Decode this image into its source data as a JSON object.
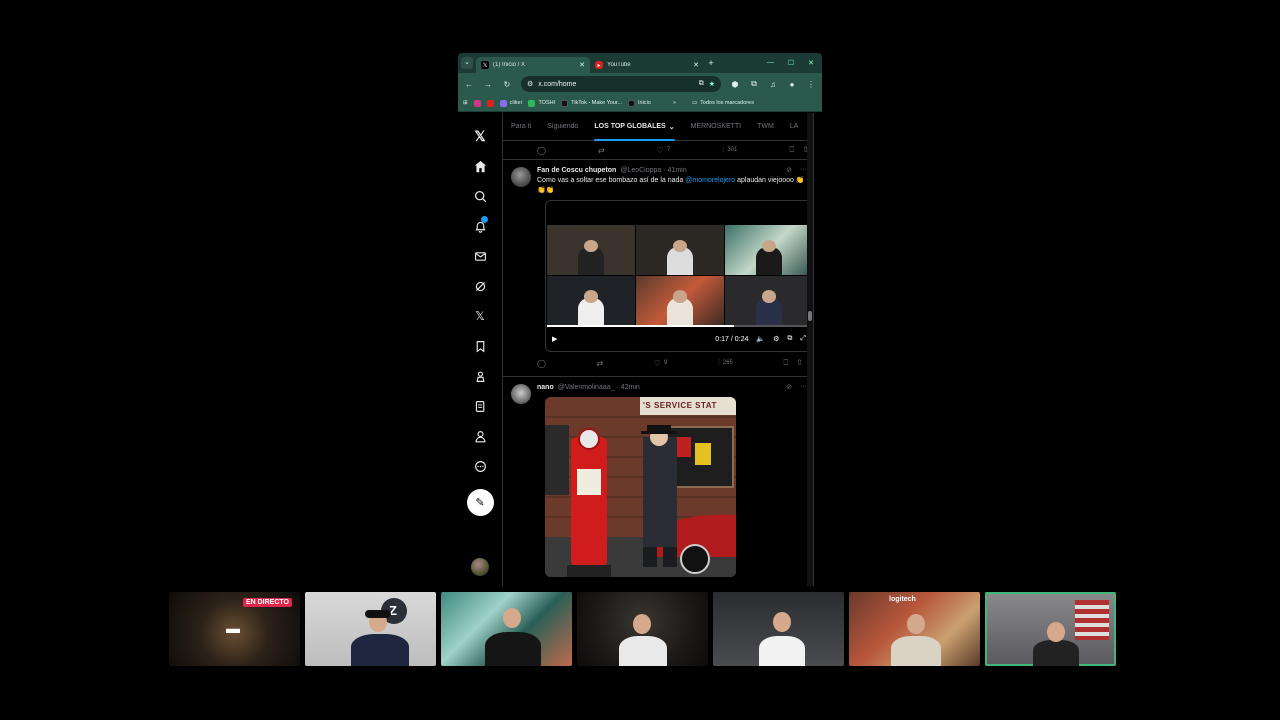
{
  "browser": {
    "tabs": [
      {
        "title": "(1) Inicio / X",
        "active": true
      },
      {
        "title": "YouTube",
        "active": false
      }
    ],
    "url": "x.com/home",
    "bookmarks": [
      {
        "label": "",
        "color": "#d1348b"
      },
      {
        "label": "",
        "color": "#e02020"
      },
      {
        "label": "cliker",
        "color": "#8a6cf0"
      },
      {
        "label": "TOSHI",
        "color": "#2db85c"
      },
      {
        "label": "TikTok - Make Your...",
        "color": "#111111"
      },
      {
        "label": "Inicio",
        "color": "#111111"
      }
    ],
    "bookmarks_overflow": "»",
    "all_bookmarks": "Todos los marcadores"
  },
  "x": {
    "feed_tabs": [
      "Para ti",
      "Siguiendo",
      "LOS TOP GLOBALES",
      "MERNOSKETTI",
      "TWM",
      "LA"
    ],
    "top_actions": {
      "likes": "7",
      "views": "301"
    },
    "tweet1": {
      "name": "Fan de Coscu chupeton",
      "handle": "@LeoCioppa · 41min",
      "text_before": "Como vas a soltar ese bombazo así de la nada ",
      "mention": "@momorelojero",
      "text_after": " aplaudan viejoooo 👏👏👏",
      "video_time": "0:17 / 0:24",
      "video_progress": 0.71,
      "likes": "9",
      "views": "265"
    },
    "tweet2": {
      "name": "nano",
      "handle": "@Valenmolinaaa_ · 42min",
      "photo_sign": "'S SERVICE STAT"
    }
  },
  "stream_strip": {
    "live_label": "EN DIRECTO",
    "cam2_logo": "Z",
    "cam6_text": "logitech"
  },
  "colors": {
    "accent": "#1d9bf0",
    "browser_frame": "#2b5a4c",
    "live": "#e0264a",
    "selected_cam": "#3fb67a"
  }
}
